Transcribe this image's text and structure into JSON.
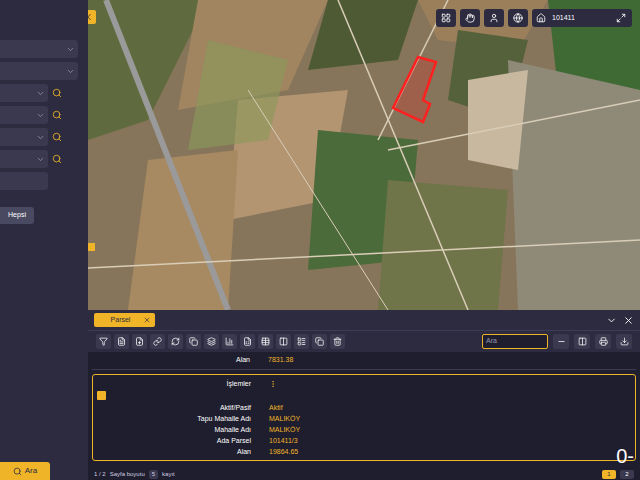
{
  "sidebar": {
    "fields": [
      {
        "kind": "select",
        "lookup": false
      },
      {
        "kind": "select",
        "lookup": false
      },
      {
        "kind": "select",
        "lookup": true
      },
      {
        "kind": "select",
        "lookup": true
      },
      {
        "kind": "select",
        "lookup": true
      },
      {
        "kind": "select",
        "lookup": true
      },
      {
        "kind": "text",
        "lookup": false
      }
    ],
    "all_button": "Hepsi",
    "search_button": "Ara"
  },
  "map": {
    "toolbar": {
      "search_value": "101411"
    },
    "parcel": {
      "highlighted": true
    }
  },
  "panel": {
    "tabs": [
      {
        "label": "Parsel",
        "selected": true
      }
    ],
    "search": {
      "placeholder": "Ara"
    },
    "summary_row": {
      "label": "Alan",
      "value": "7831.38"
    },
    "record": {
      "actions_label": "İşlemler",
      "checked": true,
      "fields": [
        {
          "label": "Aktif/Pasif",
          "value": "Aktif"
        },
        {
          "label": "Tapu Mahalle Adı",
          "value": "MALIKÖY"
        },
        {
          "label": "Mahalle Adı",
          "value": "MALIKÖY"
        },
        {
          "label": "Ada Parsel",
          "value": "101411/3"
        },
        {
          "label": "Alan",
          "value": "19864.65"
        }
      ]
    },
    "pagination": {
      "info": "1 / 2",
      "page_size_label": "Sayfa boyutu",
      "page_size": "5",
      "unit": "kayıt",
      "pages": [
        {
          "label": "1",
          "selected": true
        },
        {
          "label": "2",
          "selected": false
        }
      ]
    },
    "overflow_text": "0-"
  }
}
